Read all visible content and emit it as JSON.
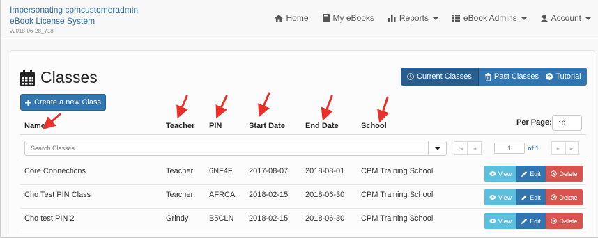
{
  "brand": {
    "line1": "Impersonating cpmcustomeradmin",
    "line2": "eBook License System",
    "version": "v2018-06-28_718"
  },
  "nav": {
    "home": "Home",
    "my_ebooks": "My eBooks",
    "reports": "Reports",
    "ebook_admins": "eBook Admins",
    "account": "Account"
  },
  "page": {
    "title": "Classes",
    "create_button": "Create a new Class",
    "current_classes": "Current Classes",
    "past_classes": "Past Classes",
    "tutorial": "Tutorial"
  },
  "table": {
    "headers": {
      "name": "Name",
      "teacher": "Teacher",
      "pin": "PIN",
      "start_date": "Start Date",
      "end_date": "End Date",
      "school": "School"
    },
    "per_page_label": "Per Page:",
    "per_page_value": "10",
    "search_placeholder": "Search Classes",
    "pager": {
      "page": "1",
      "of": "of 1"
    },
    "rows": [
      {
        "name": "Core Connections",
        "teacher": "Teacher",
        "pin": "6NF4F",
        "start": "2017-08-07",
        "end": "2018-08-01",
        "school": "CPM Training School"
      },
      {
        "name": "Cho Test PIN Class",
        "teacher": "Teacher",
        "pin": "AFRCA",
        "start": "2018-02-15",
        "end": "2018-06-30",
        "school": "CPM Training School"
      },
      {
        "name": "Cho test PIN 2",
        "teacher": "Grindy",
        "pin": "B5CLN",
        "start": "2018-02-15",
        "end": "2018-06-30",
        "school": "CPM Training School"
      }
    ],
    "actions": {
      "view": "View",
      "edit": "Edit",
      "delete": "Delete"
    }
  },
  "colors": {
    "primary": "#3276b1",
    "active": "#285e8e",
    "info": "#5bc0de",
    "danger": "#d9534f",
    "annotation_arrow": "#e8312b"
  }
}
